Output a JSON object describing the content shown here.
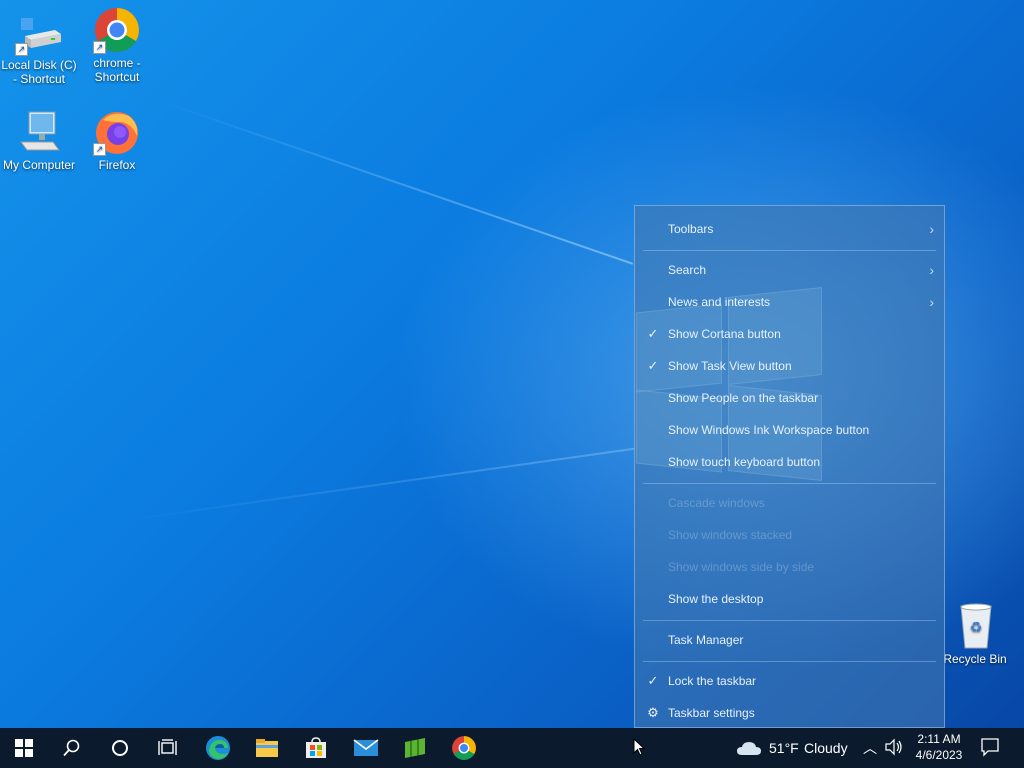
{
  "desktop": {
    "icons": [
      {
        "label": "Local Disk (C) - Shortcut"
      },
      {
        "label": "chrome - Shortcut"
      },
      {
        "label": "My Computer"
      },
      {
        "label": "Firefox"
      },
      {
        "label": "Recycle Bin"
      }
    ]
  },
  "context_menu": {
    "items": [
      {
        "label": "Toolbars",
        "checked": false,
        "submenu": true,
        "enabled": true
      },
      {
        "label": "Search",
        "checked": false,
        "submenu": true,
        "enabled": true
      },
      {
        "label": "News and interests",
        "checked": false,
        "submenu": true,
        "enabled": true
      },
      {
        "label": "Show Cortana button",
        "checked": true,
        "submenu": false,
        "enabled": true
      },
      {
        "label": "Show Task View button",
        "checked": true,
        "submenu": false,
        "enabled": true
      },
      {
        "label": "Show People on the taskbar",
        "checked": false,
        "submenu": false,
        "enabled": true
      },
      {
        "label": "Show Windows Ink Workspace button",
        "checked": false,
        "submenu": false,
        "enabled": true
      },
      {
        "label": "Show touch keyboard button",
        "checked": false,
        "submenu": false,
        "enabled": true
      },
      {
        "label": "Cascade windows",
        "checked": false,
        "submenu": false,
        "enabled": false
      },
      {
        "label": "Show windows stacked",
        "checked": false,
        "submenu": false,
        "enabled": false
      },
      {
        "label": "Show windows side by side",
        "checked": false,
        "submenu": false,
        "enabled": false
      },
      {
        "label": "Show the desktop",
        "checked": false,
        "submenu": false,
        "enabled": true
      },
      {
        "label": "Task Manager",
        "checked": false,
        "submenu": false,
        "enabled": true
      },
      {
        "label": "Lock the taskbar",
        "checked": true,
        "submenu": false,
        "enabled": true
      },
      {
        "label": "Taskbar settings",
        "checked": false,
        "submenu": false,
        "enabled": true
      }
    ]
  },
  "taskbar": {
    "apps": [
      "start-icon",
      "search-icon",
      "cortana-icon",
      "task-view-icon",
      "edge-icon",
      "file-explorer-icon",
      "store-icon",
      "mail-icon",
      "minecraft-icon",
      "chrome-icon"
    ],
    "weather": {
      "temp": "51°F",
      "condition": "Cloudy"
    },
    "clock": {
      "time": "2:11 AM",
      "date": "4/6/2023"
    }
  },
  "colors": {
    "accent": "#0078d7",
    "taskbar": "#0b1a2c"
  }
}
